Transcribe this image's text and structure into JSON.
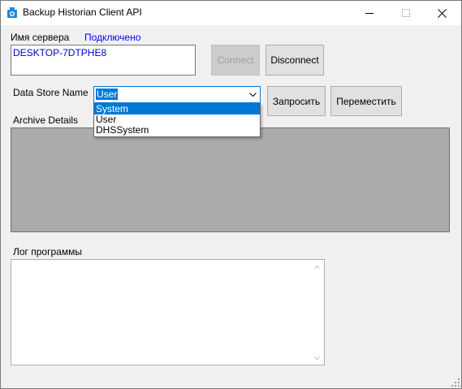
{
  "window": {
    "title": "Backup Historian Client API"
  },
  "server": {
    "label": "Имя сервера",
    "status": "Подключено",
    "name_value": "DESKTOP-7DTPHE8",
    "connect_label": "Connect",
    "disconnect_label": "Disconnect"
  },
  "datastore": {
    "label": "Data Store Name",
    "selected": "User",
    "options": [
      "System",
      "User",
      "DHSSystem"
    ],
    "query_label": "Запросить",
    "move_label": "Переместить"
  },
  "archive": {
    "label": "Archive Details"
  },
  "log": {
    "label": "Лог программы",
    "value": ""
  },
  "colors": {
    "status": "#0000ff",
    "selection": "#0078d7",
    "panel": "#ababab"
  }
}
